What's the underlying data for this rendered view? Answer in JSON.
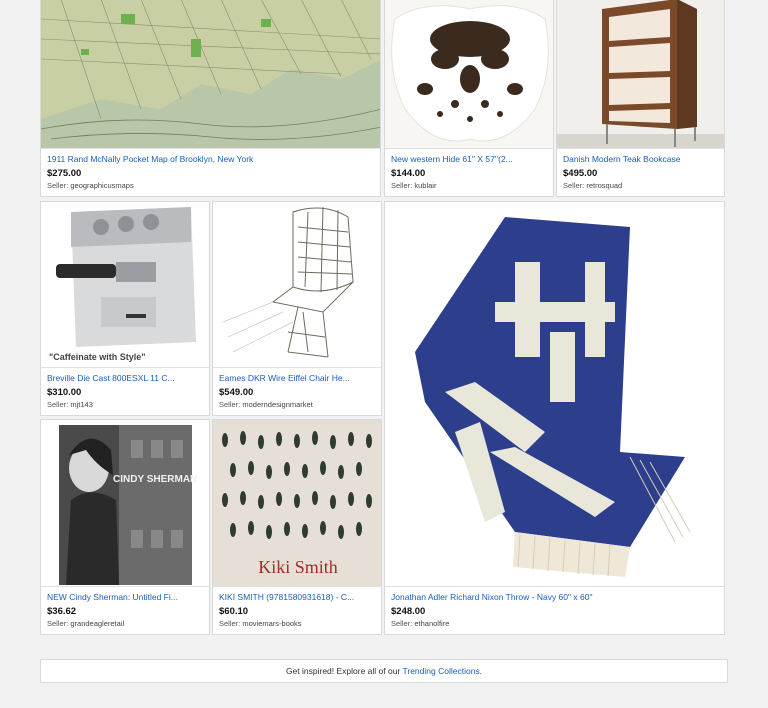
{
  "items": [
    {
      "title": "1911 Rand McNally Pocket Map of Brooklyn, New York",
      "price": "$275.00",
      "seller_label": "Seller:",
      "seller": "geographicusmaps"
    },
    {
      "title": "New western Hide 61'' X 57''(2...",
      "price": "$144.00",
      "seller_label": "Seller:",
      "seller": "kublair"
    },
    {
      "title": "Danish Modern Teak Bookcase",
      "price": "$495.00",
      "seller_label": "Seller:",
      "seller": "retrosquad"
    },
    {
      "title": "Breville Die Cast 800ESXL 11 C...",
      "price": "$310.00",
      "seller_label": "Seller:",
      "seller": "mjt143",
      "image_caption": "\"Caffeinate with Style\""
    },
    {
      "title": "Eames DKR Wire Eiffel Chair He...",
      "price": "$549.00",
      "seller_label": "Seller:",
      "seller": "moderndesignmarket"
    },
    {
      "title": "Jonathan Adler Richard Nixon Throw - Navy 60\" x 60\"",
      "price": "$248.00",
      "seller_label": "Seller:",
      "seller": "ethanolfire"
    },
    {
      "title": "NEW Cindy Sherman: Untitled Fi...",
      "price": "$36.62",
      "seller_label": "Seller:",
      "seller": "grandeagleretail",
      "book_text": "CINDY SHERMAN"
    },
    {
      "title": "KIKI SMITH (9781580931618) - C...",
      "price": "$60.10",
      "seller_label": "Seller:",
      "seller": "moviemars-books",
      "book_text": "Kiki Smith"
    }
  ],
  "footer": {
    "prefix": "Get inspired! Explore all of our ",
    "link": "Trending Collections",
    "suffix": "."
  },
  "colors": {
    "link": "#1a5fb4",
    "navy": "#2d3f8c",
    "background": "#f2f2f2"
  }
}
